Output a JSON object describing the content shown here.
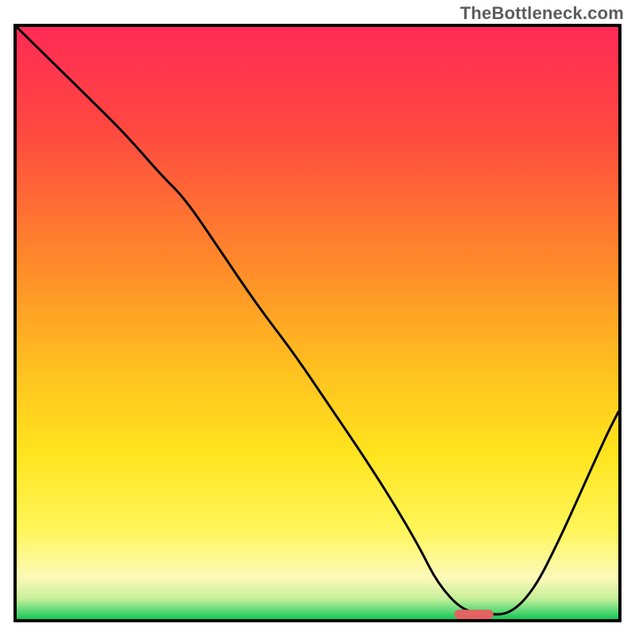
{
  "watermark": "TheBottleneck.com",
  "colors": {
    "curve": "#000000",
    "marker_fill": "#e2635f",
    "border": "#000000",
    "gradient_stops": [
      {
        "offset": 0.0,
        "color": "#ff2a55"
      },
      {
        "offset": 0.18,
        "color": "#ff4a40"
      },
      {
        "offset": 0.4,
        "color": "#ff8a2a"
      },
      {
        "offset": 0.58,
        "color": "#ffc11f"
      },
      {
        "offset": 0.72,
        "color": "#ffe41e"
      },
      {
        "offset": 0.85,
        "color": "#fff65a"
      },
      {
        "offset": 0.93,
        "color": "#fcf9b8"
      },
      {
        "offset": 0.965,
        "color": "#c7ef9a"
      },
      {
        "offset": 0.985,
        "color": "#63db7a"
      },
      {
        "offset": 1.0,
        "color": "#17c654"
      }
    ]
  },
  "chart_data": {
    "type": "line",
    "title": "",
    "xlabel": "",
    "ylabel": "",
    "xlim": [
      0,
      100
    ],
    "ylim": [
      0,
      100
    ],
    "grid": false,
    "legend": false,
    "series": [
      {
        "name": "bottleneck-curve",
        "x": [
          0,
          6,
          12,
          18,
          24,
          28,
          34,
          40,
          46,
          52,
          58,
          63,
          67,
          70,
          74,
          78,
          82,
          86,
          90,
          94,
          98,
          100
        ],
        "y": [
          100,
          94,
          88,
          82,
          75,
          71,
          62,
          53,
          45,
          36,
          27,
          19,
          12,
          6,
          1.5,
          0.8,
          0.8,
          5,
          13,
          22,
          31,
          35
        ]
      }
    ],
    "marker": {
      "name": "optimal-point",
      "x_center": 76,
      "y_center": 0.8,
      "shape": "pill",
      "width_pct": 6.5,
      "height_pct": 1.6
    }
  }
}
